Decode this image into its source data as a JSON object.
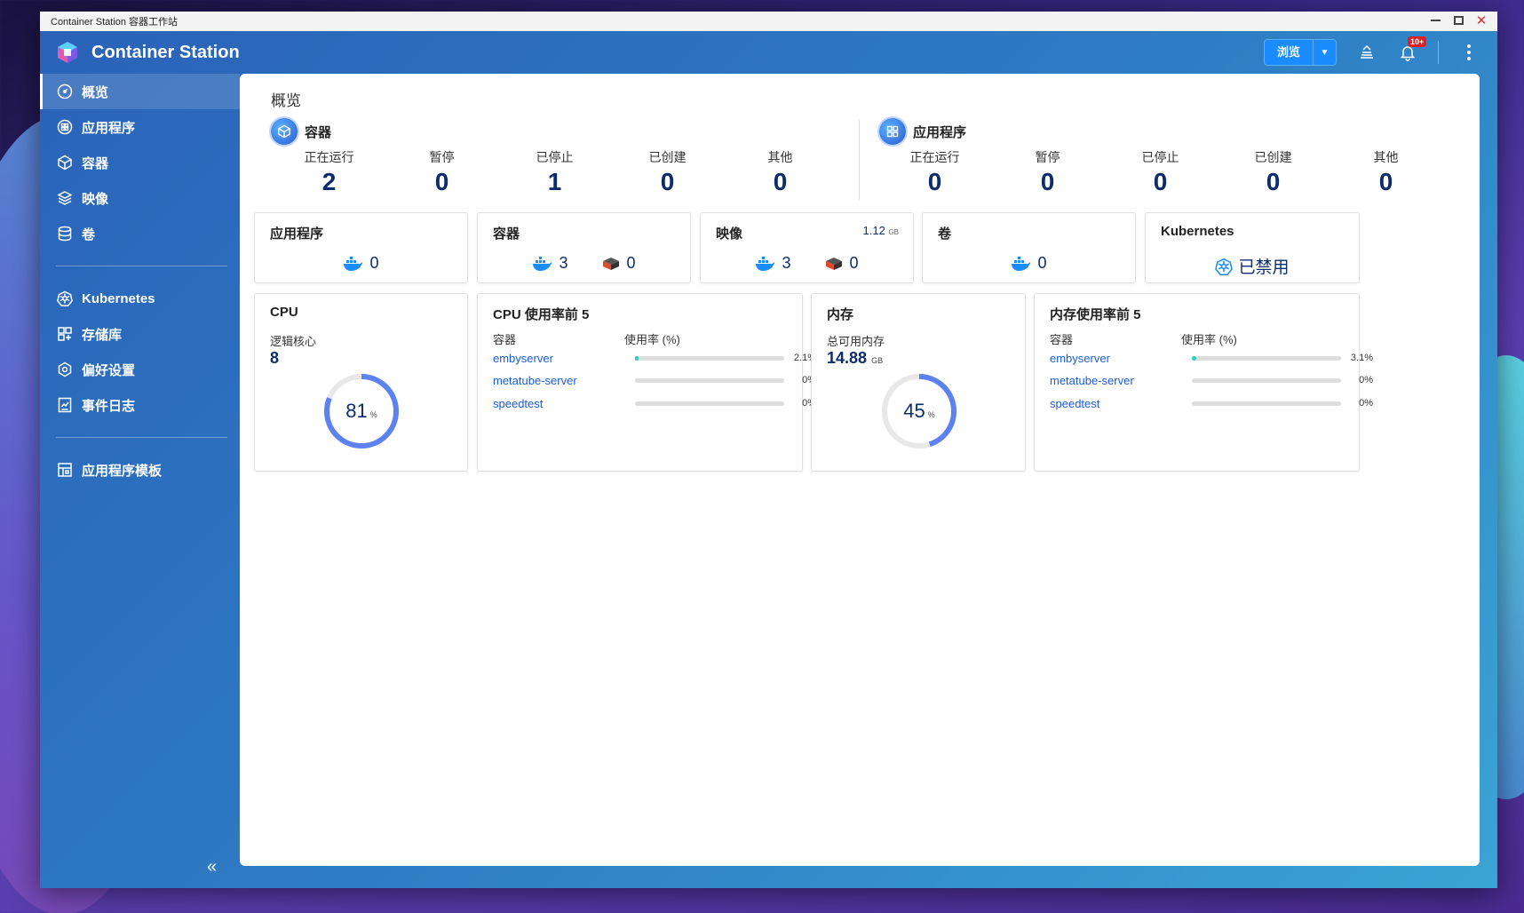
{
  "window": {
    "title": "Container Station 容器工作站"
  },
  "header": {
    "app_title": "Container Station",
    "browse_label": "浏览",
    "notif_badge": "10+"
  },
  "sidebar": {
    "items": [
      {
        "label": "概览",
        "icon": "dashboard-icon",
        "active": true
      },
      {
        "label": "应用程序",
        "icon": "apps-icon"
      },
      {
        "label": "容器",
        "icon": "container-icon"
      },
      {
        "label": "映像",
        "icon": "image-layers-icon"
      },
      {
        "label": "卷",
        "icon": "volume-icon"
      }
    ],
    "items2": [
      {
        "label": "Kubernetes",
        "icon": "kubernetes-icon"
      },
      {
        "label": "存储库",
        "icon": "repository-icon"
      },
      {
        "label": "偏好设置",
        "icon": "preferences-icon"
      },
      {
        "label": "事件日志",
        "icon": "event-log-icon"
      }
    ],
    "items3": [
      {
        "label": "应用程序模板",
        "icon": "template-icon"
      }
    ]
  },
  "main": {
    "title": "概览",
    "containers_summary": {
      "title": "容器",
      "stats": [
        {
          "label": "正在运行",
          "value": "2"
        },
        {
          "label": "暂停",
          "value": "0"
        },
        {
          "label": "已停止",
          "value": "1"
        },
        {
          "label": "已创建",
          "value": "0"
        },
        {
          "label": "其他",
          "value": "0"
        }
      ]
    },
    "apps_summary": {
      "title": "应用程序",
      "stats": [
        {
          "label": "正在运行",
          "value": "0"
        },
        {
          "label": "暂停",
          "value": "0"
        },
        {
          "label": "已停止",
          "value": "0"
        },
        {
          "label": "已创建",
          "value": "0"
        },
        {
          "label": "其他",
          "value": "0"
        }
      ]
    },
    "cards": {
      "apps": {
        "title": "应用程序",
        "docker_count": "0"
      },
      "containers": {
        "title": "容器",
        "docker_count": "3",
        "lxd_count": "0"
      },
      "images": {
        "title": "映像",
        "size": "1.12",
        "size_unit": "GB",
        "docker_count": "3",
        "lxd_count": "0"
      },
      "volumes": {
        "title": "卷",
        "docker_count": "0"
      },
      "kubernetes": {
        "title": "Kubernetes",
        "state": "已禁用"
      }
    },
    "cpu": {
      "title": "CPU",
      "cores_label": "逻辑核心",
      "cores": "8",
      "usage": 81,
      "usage_text": "81",
      "unit": "%"
    },
    "cpu_top5": {
      "title": "CPU 使用率前 5",
      "col_container": "容器",
      "col_usage": "使用率 (%)",
      "rows": [
        {
          "name": "embyserver",
          "pct": "2.1%",
          "value": 2.1
        },
        {
          "name": "metatube-server",
          "pct": "0%",
          "value": 0
        },
        {
          "name": "speedtest",
          "pct": "0%",
          "value": 0
        }
      ]
    },
    "memory": {
      "title": "内存",
      "total_label": "总可用内存",
      "total": "14.88",
      "total_unit": "GB",
      "usage": 45,
      "usage_text": "45",
      "unit": "%"
    },
    "mem_top5": {
      "title": "内存使用率前 5",
      "col_container": "容器",
      "col_usage": "使用率 (%)",
      "rows": [
        {
          "name": "embyserver",
          "pct": "3.1%",
          "value": 3.1
        },
        {
          "name": "metatube-server",
          "pct": "0%",
          "value": 0
        },
        {
          "name": "speedtest",
          "pct": "0%",
          "value": 0
        }
      ]
    }
  },
  "colors": {
    "accent": "#1a8cff",
    "value_text": "#0d2c6e",
    "donut": "#5b82f0",
    "bar_fill": "#2ad0c0"
  }
}
